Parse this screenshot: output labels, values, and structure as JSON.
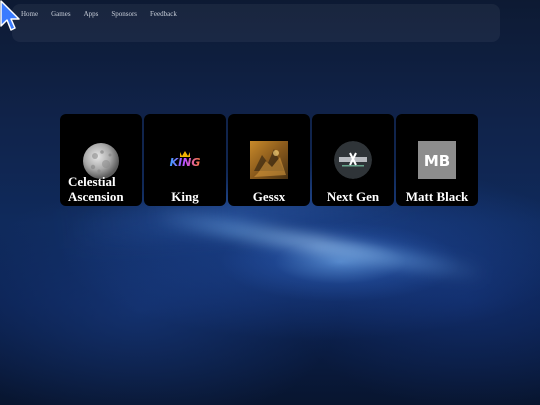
{
  "nav": {
    "items": [
      {
        "label": "Home"
      },
      {
        "label": "Games"
      },
      {
        "label": "Apps"
      },
      {
        "label": "Sponsors"
      },
      {
        "label": "Feedback"
      }
    ]
  },
  "cards": [
    {
      "label": "Celestial Ascension",
      "icon": "moon-icon"
    },
    {
      "label": "King",
      "icon": "king-logo-icon"
    },
    {
      "label": "Gessx",
      "icon": "gessx-art-icon"
    },
    {
      "label": "Next Gen",
      "icon": "next-gen-logo-icon"
    },
    {
      "label": "Matt Black",
      "icon": "mb-logo-icon",
      "logo_text": "MB"
    }
  ],
  "colors": {
    "card_bg": "#000000",
    "card_text": "#ffffff",
    "nav_text": "#c9cfda"
  }
}
